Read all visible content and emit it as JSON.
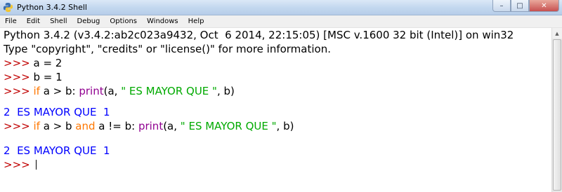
{
  "window": {
    "title": "Python 3.4.2 Shell",
    "minimize": "–",
    "maximize": "□",
    "close": "✕"
  },
  "menu": [
    "File",
    "Edit",
    "Shell",
    "Debug",
    "Options",
    "Windows",
    "Help"
  ],
  "shell": {
    "banner1": "Python 3.4.2 (v3.4.2:ab2c023a9432, Oct  6 2014, 22:15:05) [MSC v.1600 32 bit (Intel)] on win32",
    "banner2": "Type \"copyright\", \"credits\" or \"license()\" for more information.",
    "prompt": ">>> ",
    "line1_code": "a = 2",
    "line2_code": "b = 1",
    "line3": {
      "kw_if": "if",
      "cond": " a > b: ",
      "fn": "print",
      "open": "(a, ",
      "str": "\" ES MAYOR QUE \"",
      "close": ", b)"
    },
    "output1": "2  ES MAYOR QUE  1",
    "line4": {
      "kw_if": "if",
      "part1": " a > b ",
      "kw_and": "and",
      "part2": " a != b: ",
      "fn": "print",
      "open": "(a, ",
      "str": "\" ES MAYOR QUE \"",
      "close": ", b)"
    },
    "output2": "2  ES MAYOR QUE  1"
  },
  "colors": {
    "prompt": "#c00000",
    "keyword": "#ff7700",
    "builtin": "#900090",
    "string": "#00aa00",
    "output": "#0000ff"
  }
}
